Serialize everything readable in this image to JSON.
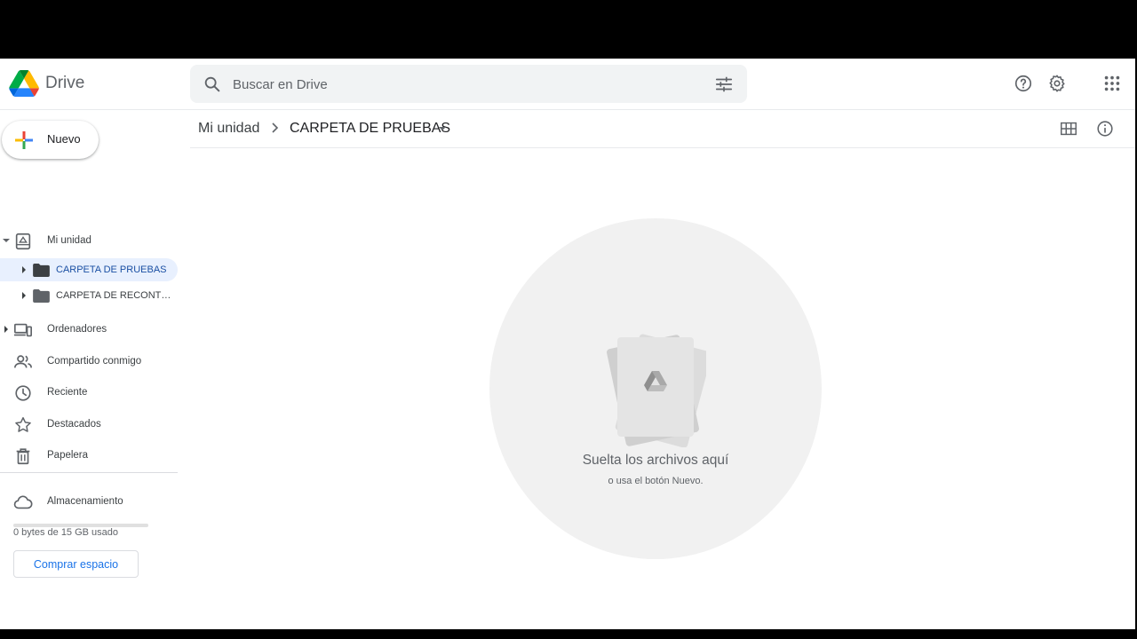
{
  "app": {
    "name": "Drive"
  },
  "search": {
    "placeholder": "Buscar en Drive"
  },
  "toolbar": {
    "icons": [
      "help-icon",
      "settings-icon",
      "apps-grid-icon"
    ]
  },
  "sidebar": {
    "new_label": "Nuevo",
    "my_drive": "Mi unidad",
    "folders": [
      {
        "label": "CARPETA DE PRUEBAS",
        "active": true
      },
      {
        "label": "CARPETA DE RECONTRA PRUEBAS",
        "active": false
      }
    ],
    "items": [
      {
        "label": "Ordenadores",
        "icon": "computers-icon"
      },
      {
        "label": "Compartido conmigo",
        "icon": "shared-icon"
      },
      {
        "label": "Reciente",
        "icon": "clock-icon"
      },
      {
        "label": "Destacados",
        "icon": "star-icon"
      },
      {
        "label": "Papelera",
        "icon": "trash-icon"
      }
    ],
    "storage": {
      "label": "Almacenamiento",
      "usage_text": "0 bytes de 15 GB usado",
      "used_fraction": 0,
      "buy_label": "Comprar espacio"
    }
  },
  "breadcrumb": {
    "root": "Mi unidad",
    "current": "CARPETA DE PRUEBAS"
  },
  "empty_state": {
    "title": "Suelta los archivos aquí",
    "subtitle": "o usa el botón Nuevo."
  },
  "colors": {
    "accent": "#1a73e8",
    "active_bg": "#e8f0fe",
    "active_text": "#1a4fa3",
    "search_bg": "#f1f3f4",
    "drop_bg": "#f1f1f1"
  }
}
